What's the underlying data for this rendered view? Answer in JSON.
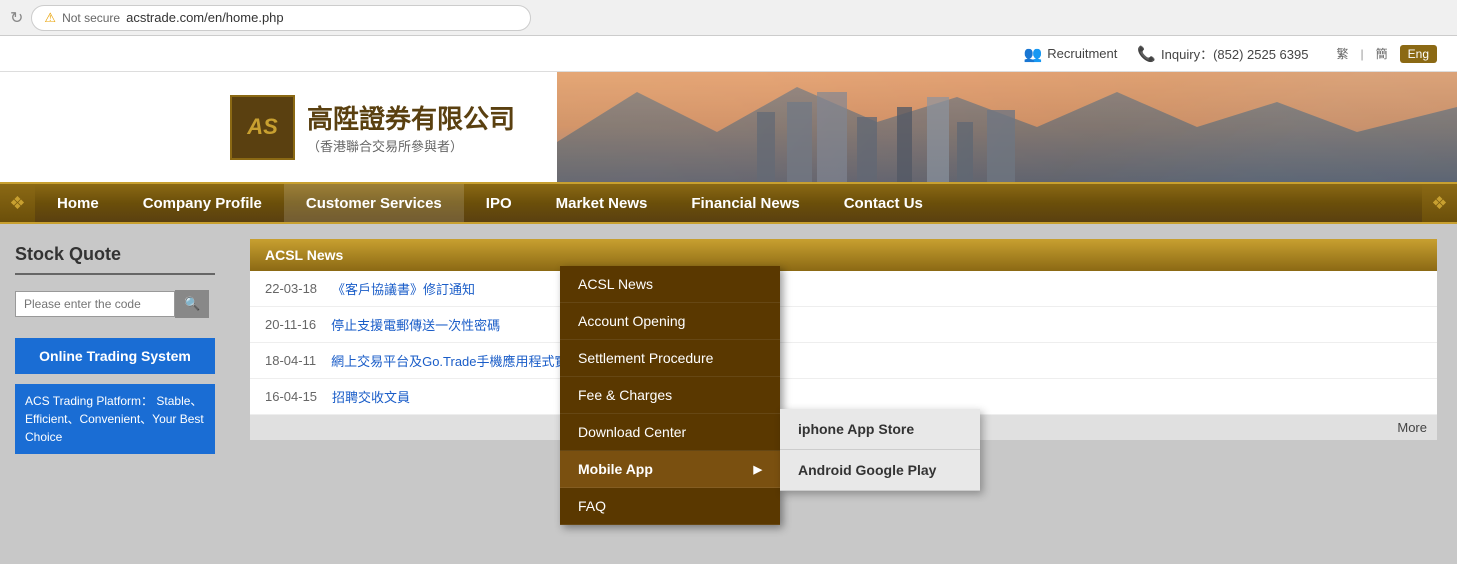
{
  "topbar": {
    "recruitment_label": "Recruitment",
    "inquiry_label": "Inquiry：(852) 2525 6395",
    "lang_tc": "繁",
    "lang_sc": "簡",
    "lang_en": "Eng"
  },
  "header": {
    "logo_letters": "AS",
    "company_name_cn": "高陞證券有限公司",
    "company_sub_cn": "（香港聯合交易所參與者）"
  },
  "nav": {
    "items": [
      {
        "label": "Home"
      },
      {
        "label": "Company Profile"
      },
      {
        "label": "Customer Services"
      },
      {
        "label": "IPO"
      },
      {
        "label": "Market News"
      },
      {
        "label": "Financial News"
      },
      {
        "label": "Contact Us"
      }
    ]
  },
  "dropdown": {
    "items": [
      {
        "label": "ACSL News"
      },
      {
        "label": "Account Opening"
      },
      {
        "label": "Settlement Procedure"
      },
      {
        "label": "Fee & Charges"
      },
      {
        "label": "Download Center"
      },
      {
        "label": "Mobile App",
        "has_sub": true
      },
      {
        "label": "FAQ"
      }
    ],
    "sub_items": [
      {
        "label": "iphone App Store"
      },
      {
        "label": "Android Google Play"
      }
    ]
  },
  "left": {
    "stock_quote_title": "Stock Quote",
    "stock_input_placeholder": "Please enter the code",
    "online_trading_label": "Online Trading System",
    "acs_platform_text": "ACS Trading Platform： Stable、Efficient、Convenient、Your Best Choice"
  },
  "news": {
    "rows": [
      {
        "date": "22-03-18",
        "text": "《客戶協議書》修訂通知"
      },
      {
        "date": "20-11-16",
        "text": "停止支援電郵傳送一次性密碼"
      },
      {
        "date": "18-04-11",
        "text": "網上交易平台及Go.Trade手機應用程式實行雙重認證"
      },
      {
        "date": "16-04-15",
        "text": "招聘交收文員"
      }
    ],
    "more_label": "More"
  },
  "browser": {
    "url": "acstrade.com/en/home.php",
    "not_secure": "Not secure"
  }
}
